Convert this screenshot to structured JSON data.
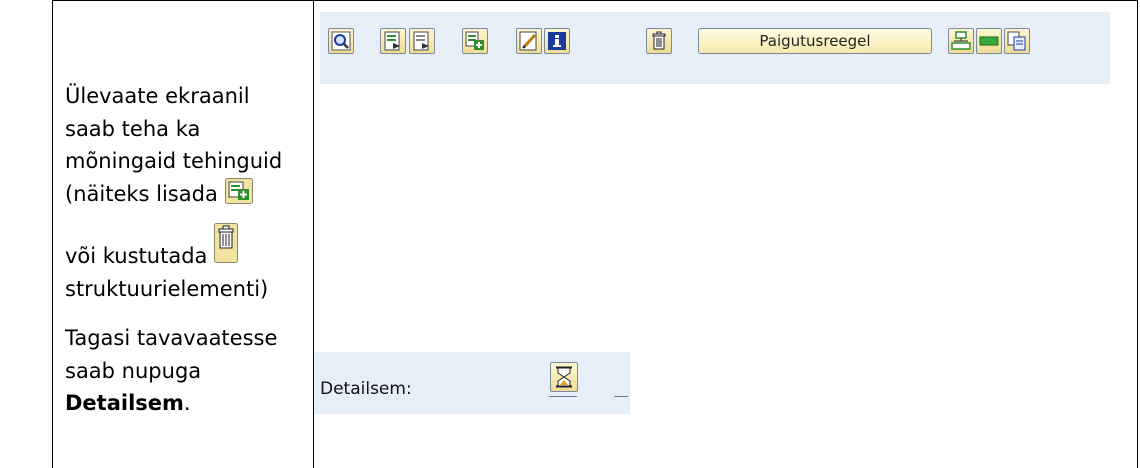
{
  "left_cell": {
    "para1": {
      "lines": [
        "Ülevaate ekraanil",
        "saab teha ka",
        "mõningaid tehinguid"
      ],
      "add_prefix": "(näiteks lisada",
      "delete_prefix": "või kustutada",
      "suffix": "struktuurielementi)"
    },
    "para2": {
      "lines": [
        "Tagasi tavavaatesse",
        "saab nupuga"
      ],
      "bold_word": "Detailsem",
      "after_bold": "."
    },
    "inline_icons": [
      "add-icon",
      "trash-icon"
    ]
  },
  "toolbar": {
    "buttons": [
      "magnifier-icon",
      "document-arrow-icon",
      "document-arrow-2-icon",
      "add-icon",
      "edit-icon",
      "info-icon",
      "trash-icon"
    ],
    "placement_rule_label": "Paigutusreegel",
    "right_buttons": [
      "hierarchy-icon",
      "collapse-icon",
      "copy-icon"
    ]
  },
  "detail_bar": {
    "label": "Detailsem:",
    "button_icon": "hourglass-icon"
  },
  "colors": {
    "toolbar_bg": "#e6eef8",
    "button_bg": "#f1dc94",
    "icon_green": "#2f8f2f",
    "icon_blue": "#1a3aa0"
  }
}
